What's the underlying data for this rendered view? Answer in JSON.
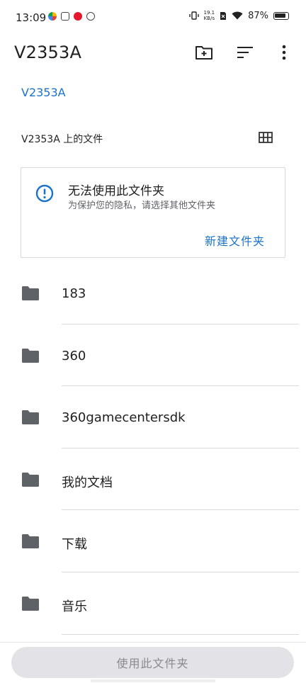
{
  "status_bar": {
    "time": "13:09",
    "net_speed_value": "19.1",
    "net_speed_unit": "KB/s",
    "battery": "87%"
  },
  "app_bar": {
    "title": "V2353A",
    "icons": [
      "new-folder-icon",
      "sort-icon",
      "more-vert-icon"
    ]
  },
  "breadcrumb": "V2353A",
  "section": {
    "title": "V2353A 上的文件",
    "view_toggle_icon": "grid-view-icon"
  },
  "warning_card": {
    "icon": "info-icon",
    "title": "无法使用此文件夹",
    "subtitle": "为保护您的隐私，请选择其他文件夹",
    "action_label": "新建文件夹"
  },
  "folders": [
    {
      "name": "183"
    },
    {
      "name": "360"
    },
    {
      "name": "360gamecentersdk"
    },
    {
      "name": "我的文档"
    },
    {
      "name": "下载"
    },
    {
      "name": "音乐"
    }
  ],
  "bottom_button": {
    "label": "使用此文件夹"
  },
  "colors": {
    "accent": "#1a73c8",
    "folder": "#5f6368",
    "disabled_button": "#e3e3e7"
  }
}
